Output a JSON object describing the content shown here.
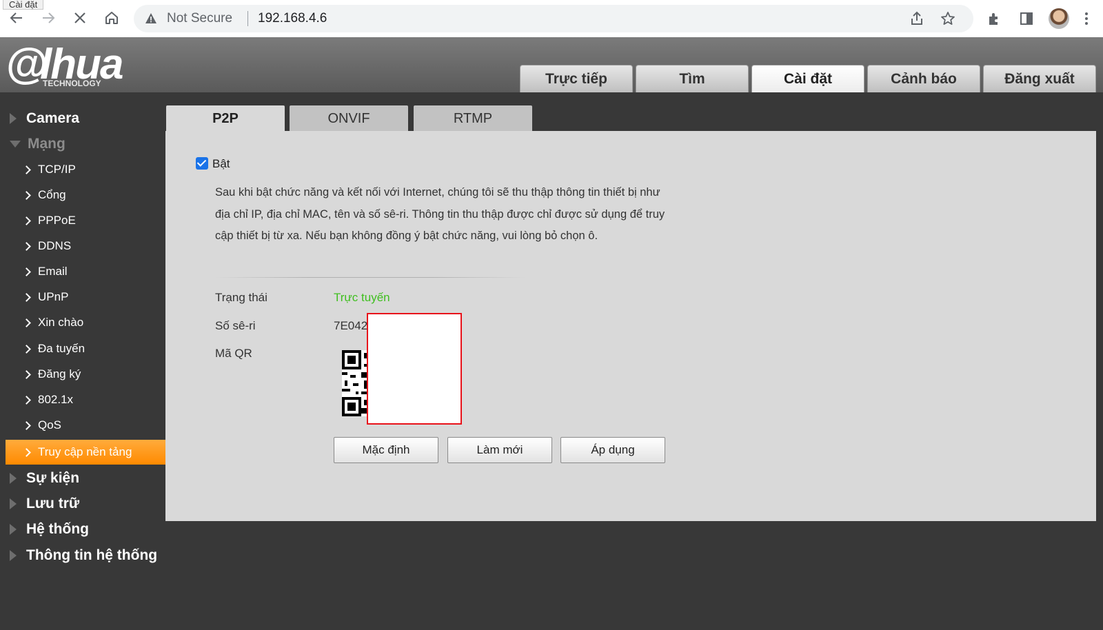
{
  "browser": {
    "tooltip": "Cài đặt",
    "security_label": "Not Secure",
    "url": "192.168.4.6",
    "icons": [
      "back-icon",
      "forward-icon",
      "stop-icon",
      "home-icon",
      "warning-icon",
      "share-icon",
      "star-icon",
      "extensions-icon",
      "sidepanel-icon",
      "profile-avatar",
      "menu-icon"
    ]
  },
  "header": {
    "logo_text": "a hua",
    "logo_sub": "TECHNOLOGY",
    "tabs": [
      {
        "label": "Trực tiếp",
        "active": false
      },
      {
        "label": "Tìm",
        "active": false
      },
      {
        "label": "Cài đặt",
        "active": true
      },
      {
        "label": "Cảnh báo",
        "active": false
      },
      {
        "label": "Đăng xuất",
        "active": false
      }
    ]
  },
  "sidebar": {
    "groups_top": [
      {
        "label": "Camera",
        "expanded": false
      },
      {
        "label": "Mạng",
        "expanded": true
      }
    ],
    "items": [
      {
        "label": "TCP/IP"
      },
      {
        "label": "Cổng"
      },
      {
        "label": "PPPoE"
      },
      {
        "label": "DDNS"
      },
      {
        "label": "Email"
      },
      {
        "label": "UPnP"
      },
      {
        "label": "Xin chào"
      },
      {
        "label": "Đa tuyến"
      },
      {
        "label": "Đăng ký"
      },
      {
        "label": "802.1x"
      },
      {
        "label": "QoS"
      },
      {
        "label": "Truy cập nền tảng",
        "active": true
      }
    ],
    "groups_bottom": [
      {
        "label": "Sự kiện"
      },
      {
        "label": "Lưu trữ"
      },
      {
        "label": "Hệ thống"
      },
      {
        "label": "Thông tin hệ thống"
      }
    ]
  },
  "content": {
    "tabs": [
      {
        "label": "P2P",
        "active": true
      },
      {
        "label": "ONVIF",
        "active": false
      },
      {
        "label": "RTMP",
        "active": false
      }
    ],
    "enable_label": "Bật",
    "enable_checked": true,
    "notice": "Sau khi bật chức năng và kết nối với Internet, chúng tôi sẽ thu thập thông tin thiết bị như địa chỉ IP, địa chỉ MAC, tên và số sê-ri. Thông tin thu thập được chỉ được sử dụng để truy cập thiết bị từ xa. Nếu bạn không đồng ý bật chức năng, vui lòng bỏ chọn ô.",
    "status_label": "Trạng thái",
    "status_value": "Trực tuyến",
    "serial_label": "Số sê-ri",
    "serial_value": "7E042",
    "qr_label": "Mã QR",
    "buttons": {
      "default": "Mặc định",
      "refresh": "Làm mới",
      "apply": "Áp dụng"
    }
  },
  "colors": {
    "accent": "#ff9a1a",
    "online": "#3fbf1f",
    "redaction_border": "#e8121a",
    "checkbox": "#1a73e8"
  }
}
